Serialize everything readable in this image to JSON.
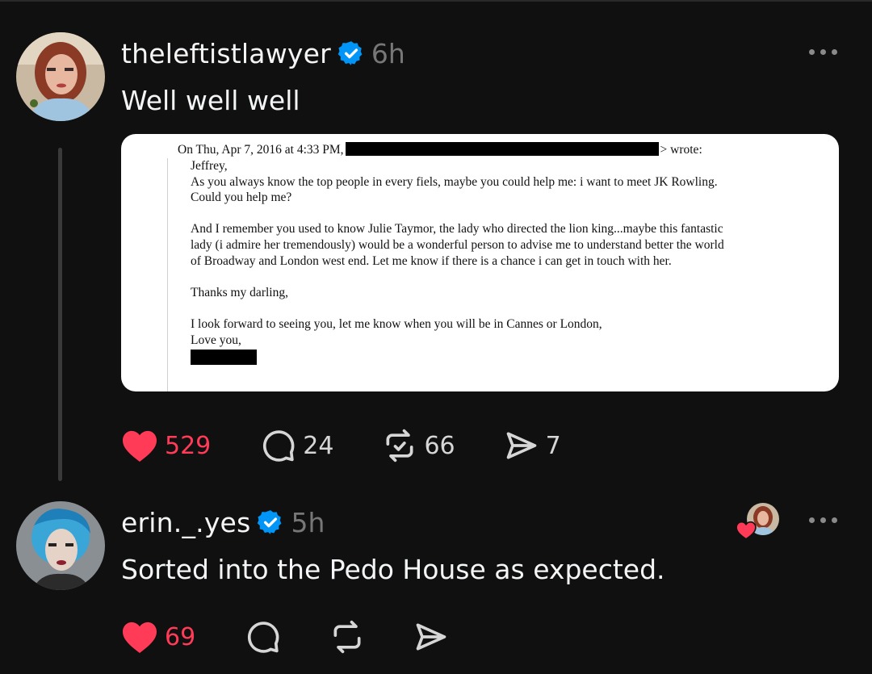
{
  "post1": {
    "username": "theleftistlawyer",
    "time": "6h",
    "text": "Well well well",
    "email": {
      "header_prefix": "On Thu, Apr 7, 2016 at 4:33 PM,",
      "header_suffix": "> wrote:",
      "lines": [
        "Jeffrey,",
        "As you always know the top people in every fiels, maybe you could help me: i want to meet JK Rowling.",
        "Could you help me?",
        "",
        "And I remember you used to know Julie Taymor, the lady who directed the lion king...maybe this fantastic",
        "lady (i admire her tremendously) would be a wonderful person to advise me to understand better the world",
        "of Broadway and London west end. Let me know if there is a chance i can get in touch with her.",
        "",
        "Thanks my darling,",
        "",
        "I look forward to seeing you, let me know when you will be in Cannes or London,",
        "Love you,"
      ]
    },
    "likes": "529",
    "replies": "24",
    "reposts": "66",
    "shares": "7"
  },
  "post2": {
    "username": "erin._.yes",
    "time": "5h",
    "text": "Sorted into the Pedo House as expected.",
    "likes": "69"
  },
  "colors": {
    "background": "#101010",
    "like_red": "#ff3b58",
    "verified_blue": "#0095f6",
    "muted": "#777777"
  },
  "icons": [
    "heart-icon",
    "comment-icon",
    "repost-icon",
    "share-icon",
    "verified-badge-icon",
    "more-icon"
  ]
}
